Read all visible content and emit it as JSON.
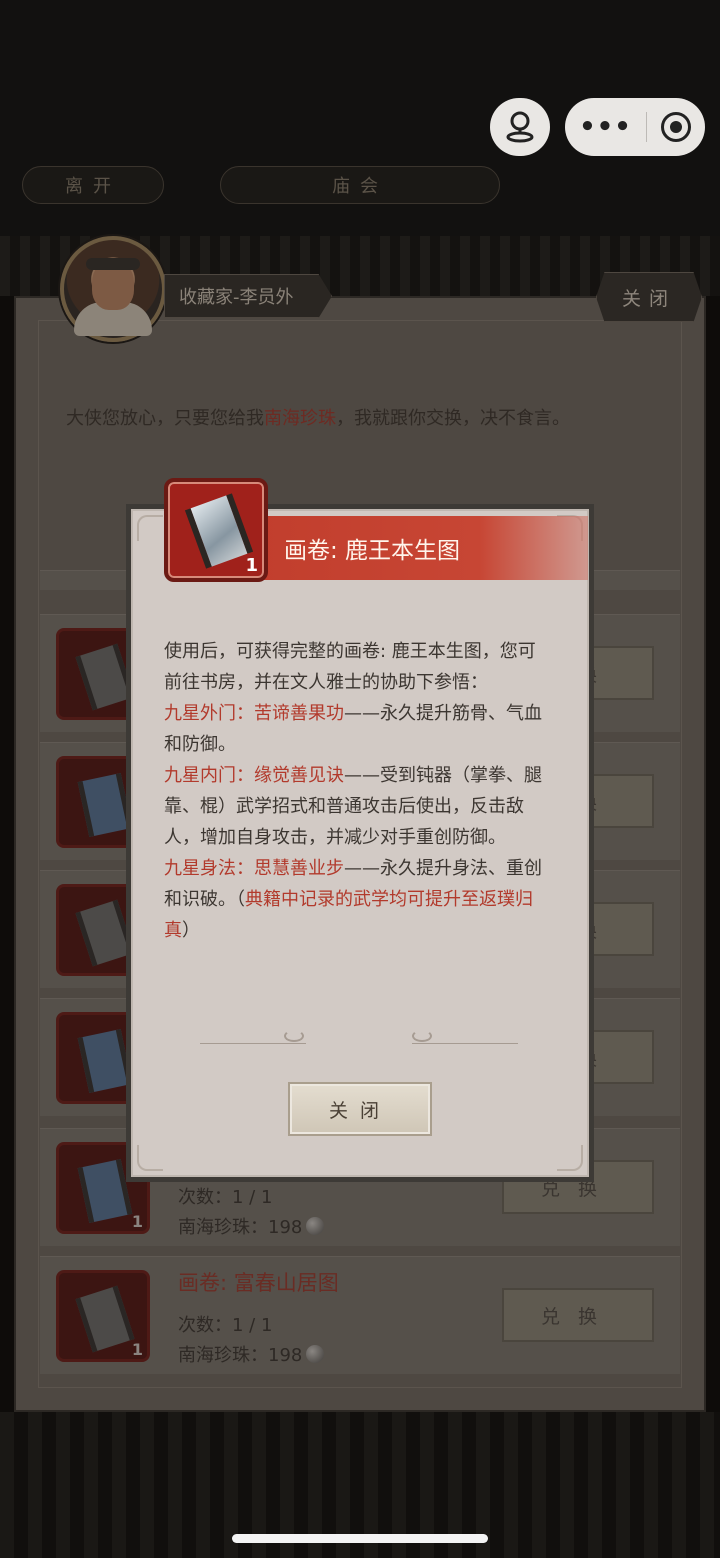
{
  "top_tabs": {
    "leave": "离开",
    "temple": "庙会"
  },
  "npc": {
    "name": "收藏家-李员外",
    "close_label": "关闭"
  },
  "dialog": {
    "prefix": "大侠您放心，只要您给我",
    "highlight": "南海珍珠",
    "suffix": "，我就跟你交换，决不食言。"
  },
  "list": {
    "exchange_label": "兑换",
    "count_prefix": "次数：",
    "cost_prefix": "南海珍珠：",
    "rows": [
      {
        "title": "",
        "count": "",
        "cost": "",
        "icon_count": ""
      },
      {
        "title": "",
        "count": "",
        "cost": "",
        "icon_count": ""
      },
      {
        "title": "",
        "count": "",
        "cost": "",
        "icon_count": ""
      },
      {
        "title": "",
        "count": "",
        "cost": "",
        "icon_count": ""
      },
      {
        "title": "",
        "count": "1 / 1",
        "cost": "198",
        "icon_count": "1"
      },
      {
        "title": "画卷: 富春山居图",
        "count": "1 / 1",
        "cost": "198",
        "icon_count": "1"
      }
    ]
  },
  "modal": {
    "title": "画卷: 鹿王本生图",
    "icon_count": "1",
    "intro": "使用后，可获得完整的画卷: 鹿王本生图，您可前往书房，并在文人雅士的协助下参悟：",
    "skill1_name": "九星外门：苦谛善果功",
    "skill1_text": "——永久提升筋骨、气血和防御。",
    "skill2_name": "九星内门：缘觉善见诀",
    "skill2_text": "——受到钝器（掌拳、腿靠、棍）武学招式和普通攻击后使出，反击敌人，增加自身攻击，并减少对手重创防御。",
    "skill3_name": "九星身法：思慧善业步",
    "skill3_text": "——永久提升身法、重创和识破。（",
    "note": "典籍中记录的武学均可提升至返璞归真",
    "note_end": "）",
    "close_label": "关闭"
  },
  "colors": {
    "accent_red": "#c13d2c",
    "text_red": "#b23a2c",
    "panel_bg": "#d2cac5"
  }
}
